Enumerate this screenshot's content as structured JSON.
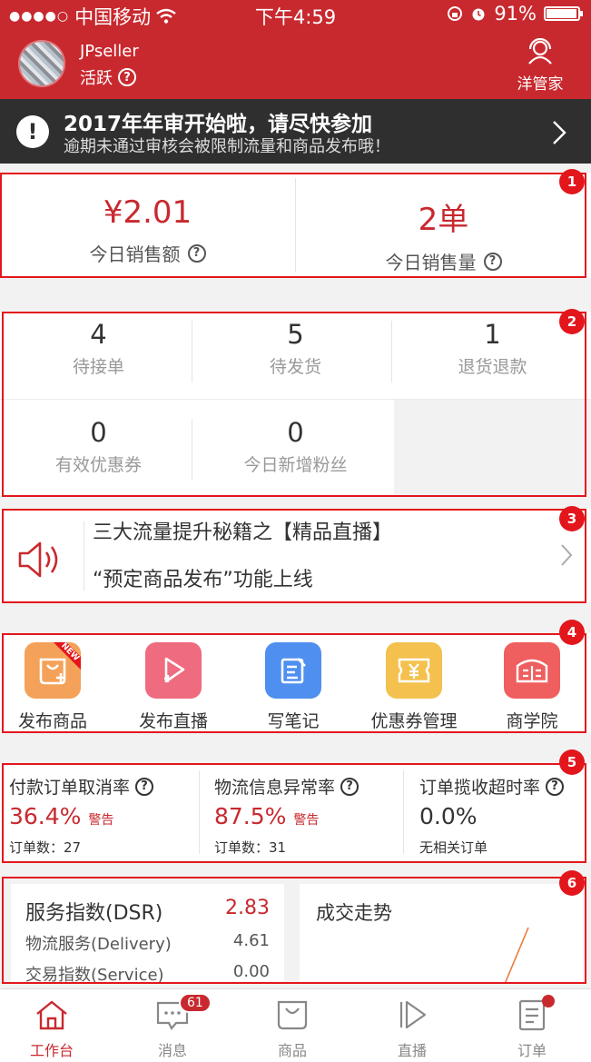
{
  "status_bar": {
    "carrier": "中国移动",
    "time": "下午4:59",
    "battery": "91%"
  },
  "header": {
    "seller_name": "JPseller",
    "status": "活跃",
    "butler_label": "洋管家"
  },
  "notice": {
    "title": "2017年年审开始啦，请尽快参加",
    "subtitle": "逾期未通过审核会被限制流量和商品发布哦！"
  },
  "sales": {
    "amount_value": "¥2.01",
    "amount_label": "今日销售额",
    "count_value": "2单",
    "count_label": "今日销售量"
  },
  "orders": {
    "items": [
      {
        "value": "4",
        "label": "待接单"
      },
      {
        "value": "5",
        "label": "待发货"
      },
      {
        "value": "1",
        "label": "退货退款"
      },
      {
        "value": "0",
        "label": "有效优惠券"
      },
      {
        "value": "0",
        "label": "今日新增粉丝"
      }
    ]
  },
  "promo": {
    "line1": "三大流量提升秘籍之【精品直播】",
    "line2": "“预定商品发布”功能上线"
  },
  "tools": {
    "new_tag": "NEW",
    "items": [
      {
        "label": "发布商品",
        "icon": "bag-plus-icon",
        "color": "#f4a259"
      },
      {
        "label": "发布直播",
        "icon": "play-plus-icon",
        "color": "#ef6b7f"
      },
      {
        "label": "写笔记",
        "icon": "note-edit-icon",
        "color": "#4f8ff0"
      },
      {
        "label": "优惠券管理",
        "icon": "coupon-icon",
        "color": "#f4c14f"
      },
      {
        "label": "商学院",
        "icon": "book-icon",
        "color": "#ef5f5f"
      }
    ]
  },
  "metrics": {
    "items": [
      {
        "title": "付款订单取消率",
        "value": "36.4%",
        "warn": "警告",
        "sub": "订单数：27"
      },
      {
        "title": "物流信息异常率",
        "value": "87.5%",
        "warn": "警告",
        "sub": "订单数：31"
      },
      {
        "title": "订单揽收超时率",
        "value": "0.0%",
        "warn": "",
        "sub": "无相关订单"
      }
    ]
  },
  "dsr": {
    "title": "服务指数(DSR)",
    "score": "2.83",
    "rows": [
      {
        "label": "物流服务(Delivery)",
        "value": "4.61"
      },
      {
        "label": "交易指数(Service)",
        "value": "0.00"
      }
    ]
  },
  "trend": {
    "title": "成交走势"
  },
  "annotations": [
    "1",
    "2",
    "3",
    "4",
    "5",
    "6"
  ],
  "tabbar": {
    "items": [
      {
        "label": "工作台",
        "icon": "home-icon"
      },
      {
        "label": "消息",
        "icon": "message-icon",
        "badge": "61"
      },
      {
        "label": "商品",
        "icon": "bag-icon"
      },
      {
        "label": "直播",
        "icon": "live-icon"
      },
      {
        "label": "订单",
        "icon": "order-icon"
      }
    ]
  },
  "colors": {
    "brand": "#c8292f",
    "annotation": "#e3161c",
    "notice_bg": "#2f2f2f"
  }
}
